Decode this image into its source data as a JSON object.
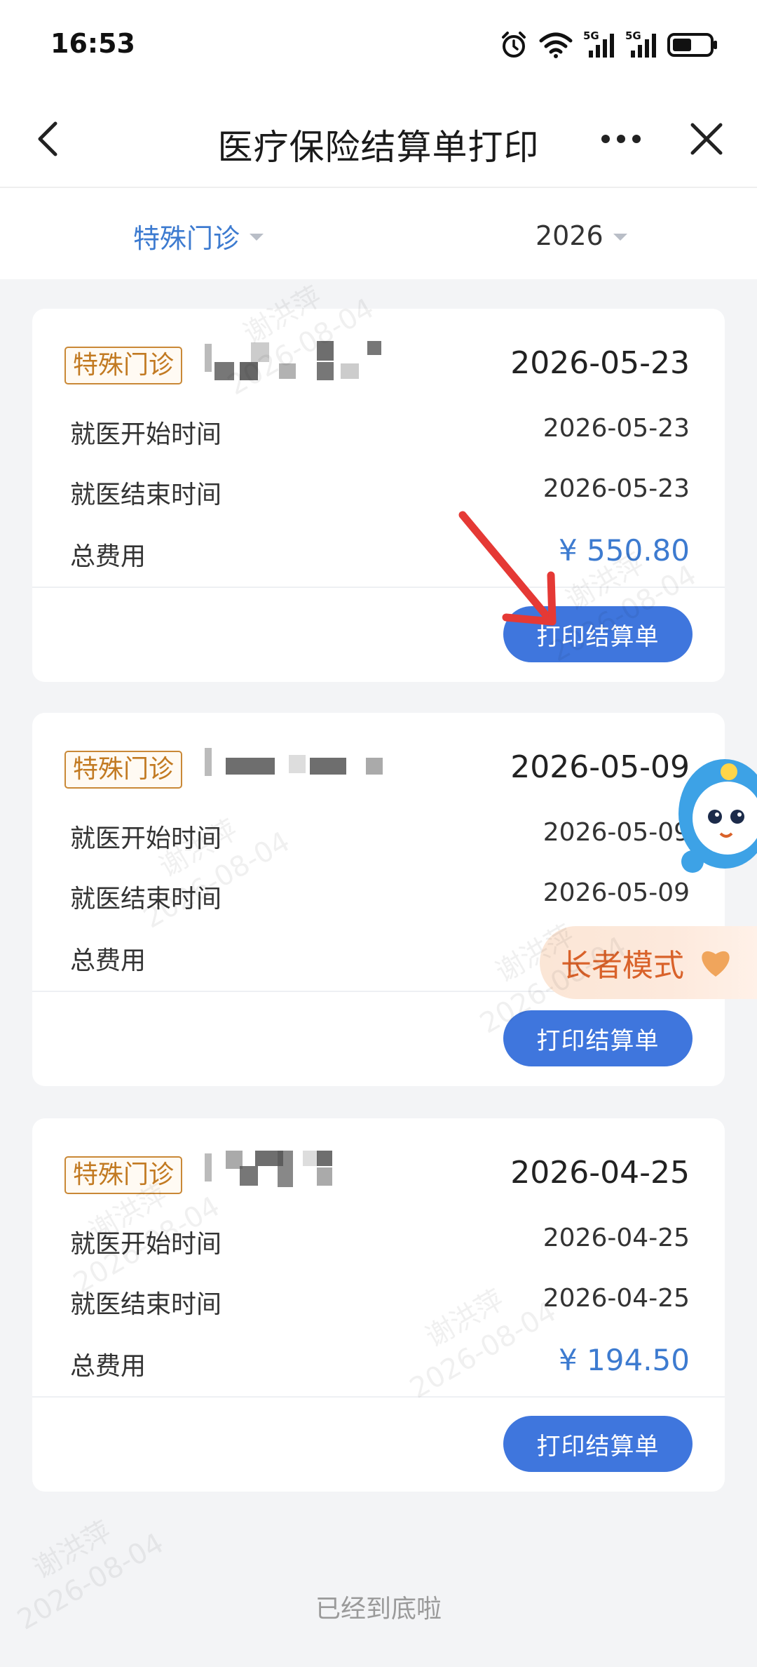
{
  "status_bar": {
    "time": "16:53",
    "signal_label_1": "5G",
    "signal_label_2": "5G"
  },
  "nav": {
    "title": "医疗保险结算单打印"
  },
  "filters": {
    "type": "特殊门诊",
    "year": "2026"
  },
  "cards": [
    {
      "badge": "特殊门诊",
      "date": "2026-05-23",
      "start_label": "就医开始时间",
      "start_value": "2026-05-23",
      "end_label": "就医结束时间",
      "end_value": "2026-05-23",
      "total_label": "总费用",
      "total_value": "¥ 550.80",
      "button": "打印结算单"
    },
    {
      "badge": "特殊门诊",
      "date": "2026-05-09",
      "start_label": "就医开始时间",
      "start_value": "2026-05-09",
      "end_label": "就医结束时间",
      "end_value": "2026-05-09",
      "total_label": "总费用",
      "total_value": "",
      "button": "打印结算单"
    },
    {
      "badge": "特殊门诊",
      "date": "2026-04-25",
      "start_label": "就医开始时间",
      "start_value": "2026-04-25",
      "end_label": "就医结束时间",
      "end_value": "2026-04-25",
      "total_label": "总费用",
      "total_value": "¥ 194.50",
      "button": "打印结算单"
    }
  ],
  "elder_mode": {
    "label": "长者模式"
  },
  "footer": {
    "text": "已经到底啦"
  },
  "watermark": {
    "name": "谢洪萍",
    "date": "2026-08-04"
  },
  "colors": {
    "accent": "#3f76dd",
    "badge": "#c27a22",
    "amount": "#3d7bd0",
    "elder_text": "#d9622a",
    "arrow": "#e53935"
  }
}
